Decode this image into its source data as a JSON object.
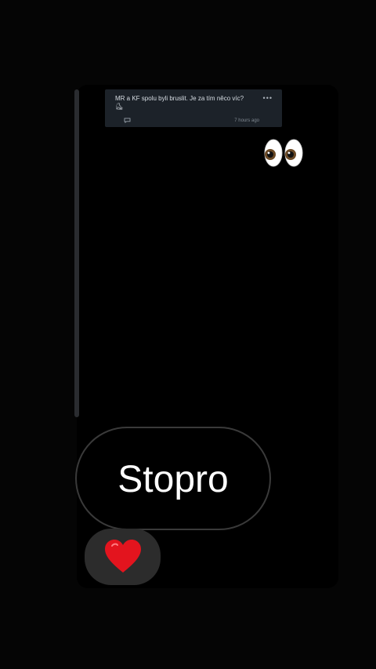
{
  "post": {
    "text": "MR a KF spolu byli bruslit. Je za tím něco víc? ⛸",
    "time": "7 hours ago",
    "more_icon": "ellipsis-icon",
    "comment_icon": "comment-icon"
  },
  "reaction_emoji": "eyes-emoji",
  "reply": {
    "text": "Stopro"
  },
  "reaction_button": {
    "icon": "heart-icon",
    "color": "#e3141e"
  },
  "colors": {
    "background": "#000000",
    "card": "#1c2229",
    "bubble_border": "#3a3a3a",
    "reaction_bg": "#2c2c2c"
  }
}
